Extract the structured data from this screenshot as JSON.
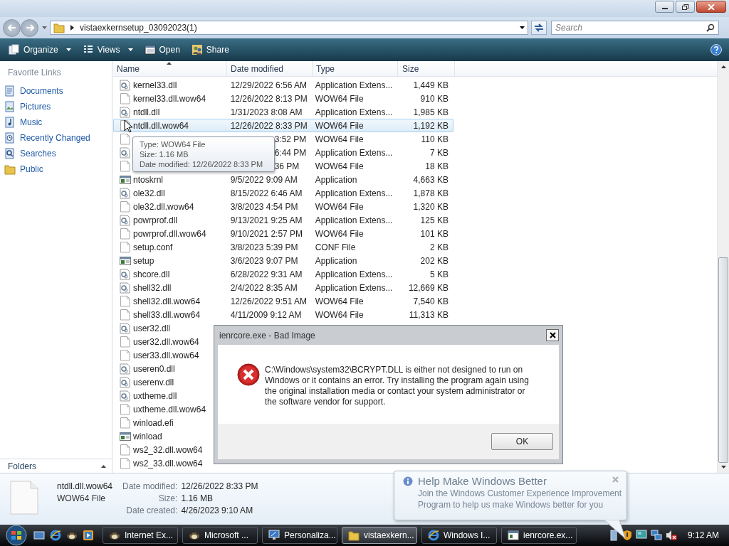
{
  "address_bar": {
    "path": "vistaexkernsetup_03092023(1)"
  },
  "search": {
    "placeholder": "Search"
  },
  "toolbar": {
    "buttons": [
      {
        "label": "Organize",
        "kind": "organize"
      },
      {
        "label": "Views",
        "kind": "views"
      },
      {
        "label": "Open",
        "kind": "open"
      },
      {
        "label": "Share",
        "kind": "share"
      }
    ]
  },
  "sidebar": {
    "heading": "Favorite Links",
    "items": [
      {
        "label": "Documents",
        "kind": "documents"
      },
      {
        "label": "Pictures",
        "kind": "pictures"
      },
      {
        "label": "Music",
        "kind": "music"
      },
      {
        "label": "Recently Changed",
        "kind": "recent"
      },
      {
        "label": "Searches",
        "kind": "searches"
      },
      {
        "label": "Public",
        "kind": "public"
      }
    ],
    "folders_label": "Folders"
  },
  "file_list": {
    "columns": [
      {
        "label": "Name",
        "sorted": true
      },
      {
        "label": "Date modified",
        "sorted": false
      },
      {
        "label": "Type",
        "sorted": false
      },
      {
        "label": "Size",
        "sorted": false
      }
    ],
    "rows": [
      {
        "name": "kernel33.dll",
        "date_modified": "12/29/2022 6:56 AM",
        "type": "Application Extens...",
        "size": "1,449 KB",
        "kind": "dll",
        "selected": false
      },
      {
        "name": "kernel33.dll.wow64",
        "date_modified": "12/26/2022 8:13 PM",
        "type": "WOW64 File",
        "size": "910 KB",
        "kind": "file",
        "selected": false
      },
      {
        "name": "ntdll.dll",
        "date_modified": "1/31/2023 8:08 AM",
        "type": "Application Extens...",
        "size": "1,985 KB",
        "kind": "dll",
        "selected": false
      },
      {
        "name": "ntdll.dll.wow64",
        "date_modified": "12/26/2022 8:33 PM",
        "type": "WOW64 File",
        "size": "1,192 KB",
        "kind": "file",
        "selected": true
      },
      {
        "date_modified": "3:52 PM",
        "type": "WOW64 File",
        "size": "110 KB",
        "kind": "file",
        "selected": false
      },
      {
        "date_modified": "6:44 PM",
        "type": "Application Extens...",
        "size": "7 KB",
        "kind": "dll",
        "selected": false
      },
      {
        "date_modified": "36 PM",
        "type": "WOW64 File",
        "size": "18 KB",
        "kind": "file",
        "selected": false
      },
      {
        "name": "ntoskrnl",
        "date_modified": "9/5/2022 9:09 AM",
        "type": "Application",
        "size": "4,663 KB",
        "kind": "app",
        "selected": false
      },
      {
        "name": "ole32.dll",
        "date_modified": "8/15/2022 6:46 AM",
        "type": "Application Extens...",
        "size": "1,878 KB",
        "kind": "dll",
        "selected": false
      },
      {
        "name": "ole32.dll.wow64",
        "date_modified": "3/8/2023 4:54 PM",
        "type": "WOW64 File",
        "size": "1,320 KB",
        "kind": "file",
        "selected": false
      },
      {
        "name": "powrprof.dll",
        "date_modified": "9/13/2021 9:25 AM",
        "type": "Application Extens...",
        "size": "125 KB",
        "kind": "dll",
        "selected": false
      },
      {
        "name": "powrprof.dll.wow64",
        "date_modified": "9/10/2021 2:57 PM",
        "type": "WOW64 File",
        "size": "101 KB",
        "kind": "file",
        "selected": false
      },
      {
        "name": "setup.conf",
        "date_modified": "3/8/2023 5:39 PM",
        "type": "CONF File",
        "size": "2 KB",
        "kind": "file",
        "selected": false
      },
      {
        "name": "setup",
        "date_modified": "3/6/2023 9:07 PM",
        "type": "Application",
        "size": "202 KB",
        "kind": "app",
        "selected": false
      },
      {
        "name": "shcore.dll",
        "date_modified": "6/28/2022 9:31 AM",
        "type": "Application Extens...",
        "size": "5 KB",
        "kind": "dll",
        "selected": false
      },
      {
        "name": "shell32.dll",
        "date_modified": "2/4/2022 8:35 AM",
        "type": "Application Extens...",
        "size": "12,669 KB",
        "kind": "dll",
        "selected": false
      },
      {
        "name": "shell32.dll.wow64",
        "date_modified": "12/26/2022 9:51 AM",
        "type": "WOW64 File",
        "size": "7,540 KB",
        "kind": "file",
        "selected": false
      },
      {
        "name": "shell33.dll.wow64",
        "date_modified": "4/11/2009 9:12 AM",
        "type": "WOW64 File",
        "size": "11,313 KB",
        "kind": "file",
        "selected": false
      },
      {
        "name": "user32.dll",
        "kind": "dll",
        "selected": false
      },
      {
        "name": "user32.dll.wow64",
        "kind": "file",
        "selected": false
      },
      {
        "name": "user33.dll.wow64",
        "kind": "file",
        "selected": false
      },
      {
        "name": "useren0.dll",
        "kind": "dll",
        "selected": false
      },
      {
        "name": "userenv.dll",
        "kind": "dll",
        "selected": false
      },
      {
        "name": "uxtheme.dll",
        "kind": "dll",
        "selected": false
      },
      {
        "name": "uxtheme.dll.wow64",
        "kind": "file",
        "selected": false
      },
      {
        "name": "winload.efi",
        "kind": "file",
        "selected": false
      },
      {
        "name": "winload",
        "kind": "app",
        "selected": false
      },
      {
        "name": "ws2_32.dll.wow64",
        "kind": "file",
        "selected": false
      },
      {
        "name": "ws2_33.dll.wow64",
        "kind": "file",
        "selected": false
      }
    ]
  },
  "tooltip": {
    "lines": [
      "Type: WOW64 File",
      "Size: 1.16 MB",
      "Date modified: 12/26/2022 8:33 PM"
    ]
  },
  "details": {
    "name": "ntdll.dll.wow64",
    "type": "WOW64 File",
    "fields": [
      {
        "label": "Date modified:",
        "value": "12/26/2022 8:33 PM"
      },
      {
        "label": "Size:",
        "value": "1.16 MB"
      },
      {
        "label": "Date created:",
        "value": "4/26/2023 9:10 AM"
      }
    ]
  },
  "dialog": {
    "title": "ienrcore.exe - Bad Image",
    "message": "C:\\Windows\\system32\\BCRYPT.DLL is either not designed to run on Windows or it contains an error. Try installing the program again using the original installation media or contact your system administrator or the software vendor for support.",
    "button": "OK"
  },
  "balloon": {
    "title": "Help Make Windows Better",
    "text": "Join the Windows Customer Experience Improvement Program to help us make Windows better for you"
  },
  "taskbar": {
    "tasks": [
      {
        "label": "Internet Ex...",
        "kind": "animal",
        "selected": false
      },
      {
        "label": "Microsoft ...",
        "kind": "animal",
        "selected": false
      },
      {
        "label": "Personaliza...",
        "kind": "display",
        "selected": false
      },
      {
        "label": "vistaexkern...",
        "kind": "folder",
        "selected": true
      },
      {
        "label": "Windows I...",
        "kind": "browser",
        "selected": false
      },
      {
        "label": "ienrcore.ex...",
        "kind": "window",
        "selected": false
      }
    ],
    "clock": "9:12 AM"
  }
}
